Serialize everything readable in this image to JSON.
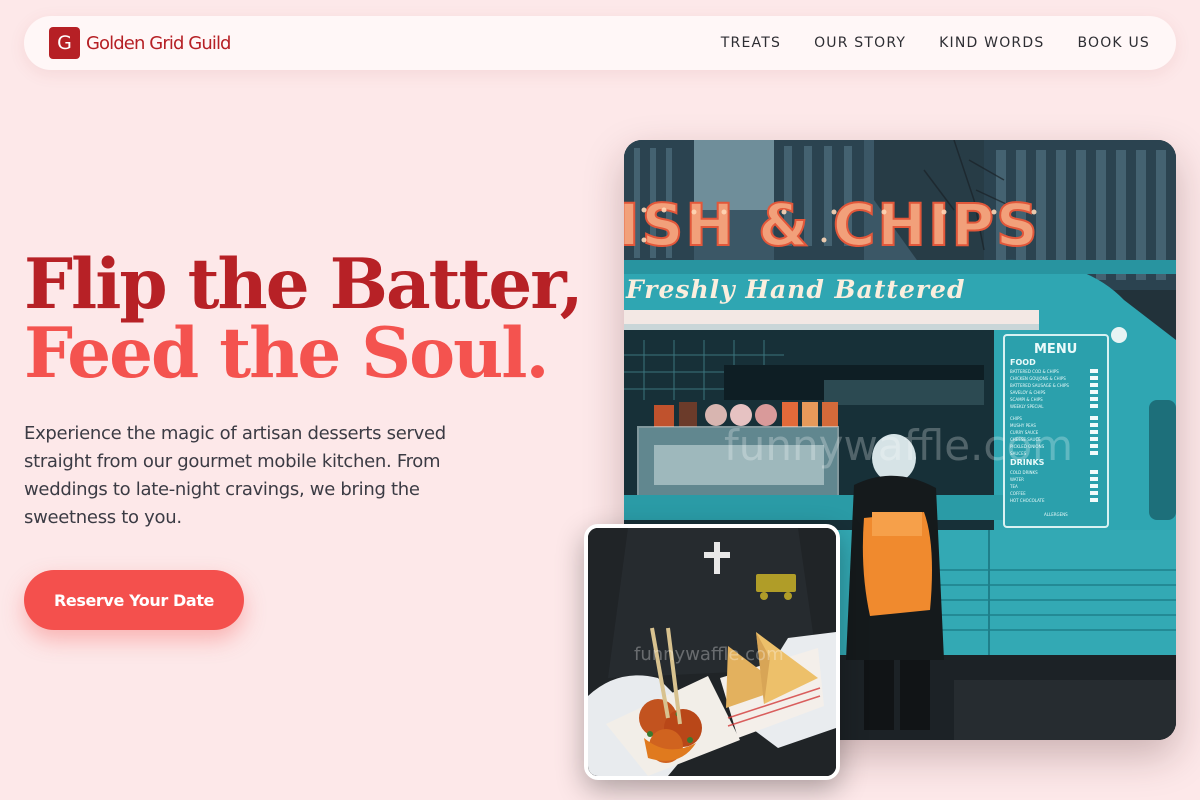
{
  "brand": {
    "logo_letter": "G",
    "name": "Golden Grid Guild"
  },
  "nav": {
    "items": [
      {
        "label": "TREATS"
      },
      {
        "label": "OUR STORY"
      },
      {
        "label": "KIND WORDS"
      },
      {
        "label": "BOOK US"
      }
    ]
  },
  "hero": {
    "title_line1": "Flip the Batter,",
    "title_line2": "Feed the Soul.",
    "description": "Experience the magic of artisan desserts served straight from our gourmet mobile kitchen. From weddings to late-night cravings, we bring the sweetness to you.",
    "cta_label": "Reserve Your Date"
  },
  "truck_image": {
    "sign_text": "ISH & CHIPS",
    "banner_text": "Freshly Hand Battered",
    "menu": {
      "title": "MENU",
      "food_heading": "FOOD",
      "food_items": [
        "BATTERED COD & CHIPS",
        "CHICKEN GOUJONS & CHIPS",
        "BATTERED SAUSAGE & CHIPS",
        "SAVELOY & CHIPS",
        "SCAMPI & CHIPS",
        "WEEKLY SPECIAL"
      ],
      "extra_items": [
        "CHIPS",
        "MUSHY PEAS",
        "CURRY SAUCE",
        "CHEESE SAUCE",
        "PICKLED ONIONS",
        "SAUCES"
      ],
      "drinks_heading": "DRINKS",
      "drink_items": [
        "COLD DRINKS",
        "WATER",
        "TEA",
        "COFFEE",
        "HOT CHOCOLATE"
      ],
      "footer": "ALLERGENS"
    },
    "watermark": "funnywaffle.com"
  },
  "food_image": {
    "watermark": "funnywaffle.com"
  },
  "colors": {
    "background": "#fde8e9",
    "brand_red": "#b62025",
    "accent_coral": "#f4504d",
    "text_dark": "#3b3b44"
  }
}
